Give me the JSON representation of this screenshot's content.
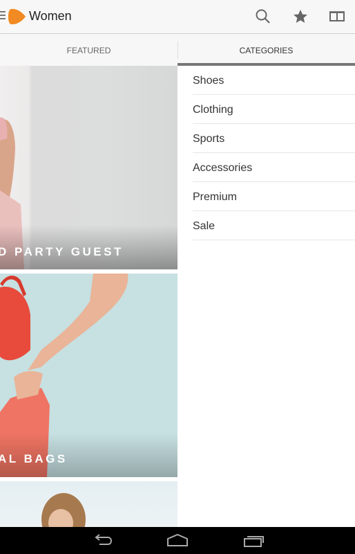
{
  "actionbar": {
    "title": "Women",
    "icons": [
      "menu-icon",
      "zalando-logo",
      "search-icon",
      "star-icon",
      "book-icon"
    ],
    "logo_color": "#f18a22"
  },
  "tabs": [
    {
      "label": "FEATURED",
      "active": false
    },
    {
      "label": "CATEGORIES",
      "active": true
    }
  ],
  "featured": {
    "cards": [
      {
        "label": "D PARTY GUEST"
      },
      {
        "label": "AL BAGS"
      },
      {
        "label": ""
      }
    ]
  },
  "categories": {
    "items": [
      {
        "label": "Shoes"
      },
      {
        "label": "Clothing"
      },
      {
        "label": "Sports"
      },
      {
        "label": "Accessories"
      },
      {
        "label": "Premium"
      },
      {
        "label": "Sale"
      }
    ]
  },
  "navbar": {
    "buttons": [
      "back-icon",
      "home-icon",
      "recent-apps-icon"
    ]
  }
}
